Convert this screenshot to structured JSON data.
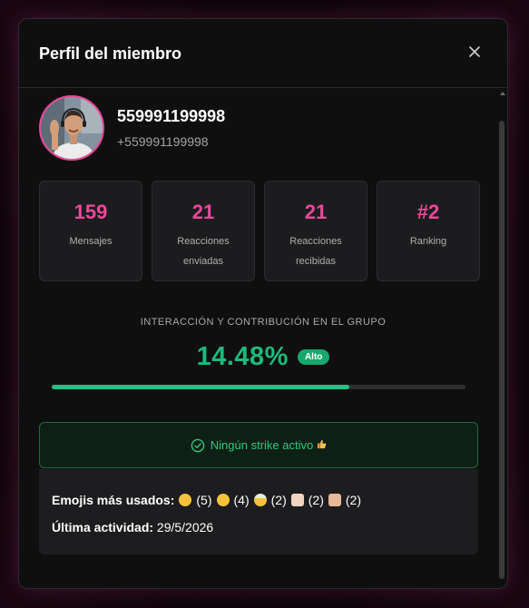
{
  "modal": {
    "title": "Perfil del miembro",
    "close_icon": "close-icon"
  },
  "profile": {
    "name": "559991199998",
    "phone": "+559991199998",
    "avatar_icon": "user-photo"
  },
  "stats": [
    {
      "value": "159",
      "label": "Mensajes"
    },
    {
      "value": "21",
      "label": "Reacciones enviadas"
    },
    {
      "value": "21",
      "label": "Reacciones recibidas"
    },
    {
      "value": "#2",
      "label": "Ranking"
    }
  ],
  "interaction": {
    "heading": "INTERACCIÓN Y CONTRIBUCIÓN EN EL GRUPO",
    "value": "14.48%",
    "level": "Alto",
    "progress_fraction": 0.72
  },
  "strike": {
    "text": "Ningún strike activo",
    "icon": "check-circle-icon",
    "suffix_icon": "thumbs-up-icon"
  },
  "info": {
    "emojis_label": "Emojis más usados:",
    "emojis": [
      {
        "emoji": "face-with-tears-of-joy",
        "count": "(5)"
      },
      {
        "emoji": "astonished-face",
        "count": "(4)"
      },
      {
        "emoji": "exploding-head",
        "count": "(2)"
      },
      {
        "emoji": "thumbs-up-light-skin",
        "count": "(2)"
      },
      {
        "emoji": "folded-hands",
        "count": "(2)"
      }
    ],
    "activity_label": "Última actividad:",
    "activity_value": "29/5/2026"
  },
  "colors": {
    "accent_pink": "#ec4899",
    "success_green": "#22c083",
    "panel_bg": "#0f0f10",
    "card_bg": "#1c1c1e"
  }
}
